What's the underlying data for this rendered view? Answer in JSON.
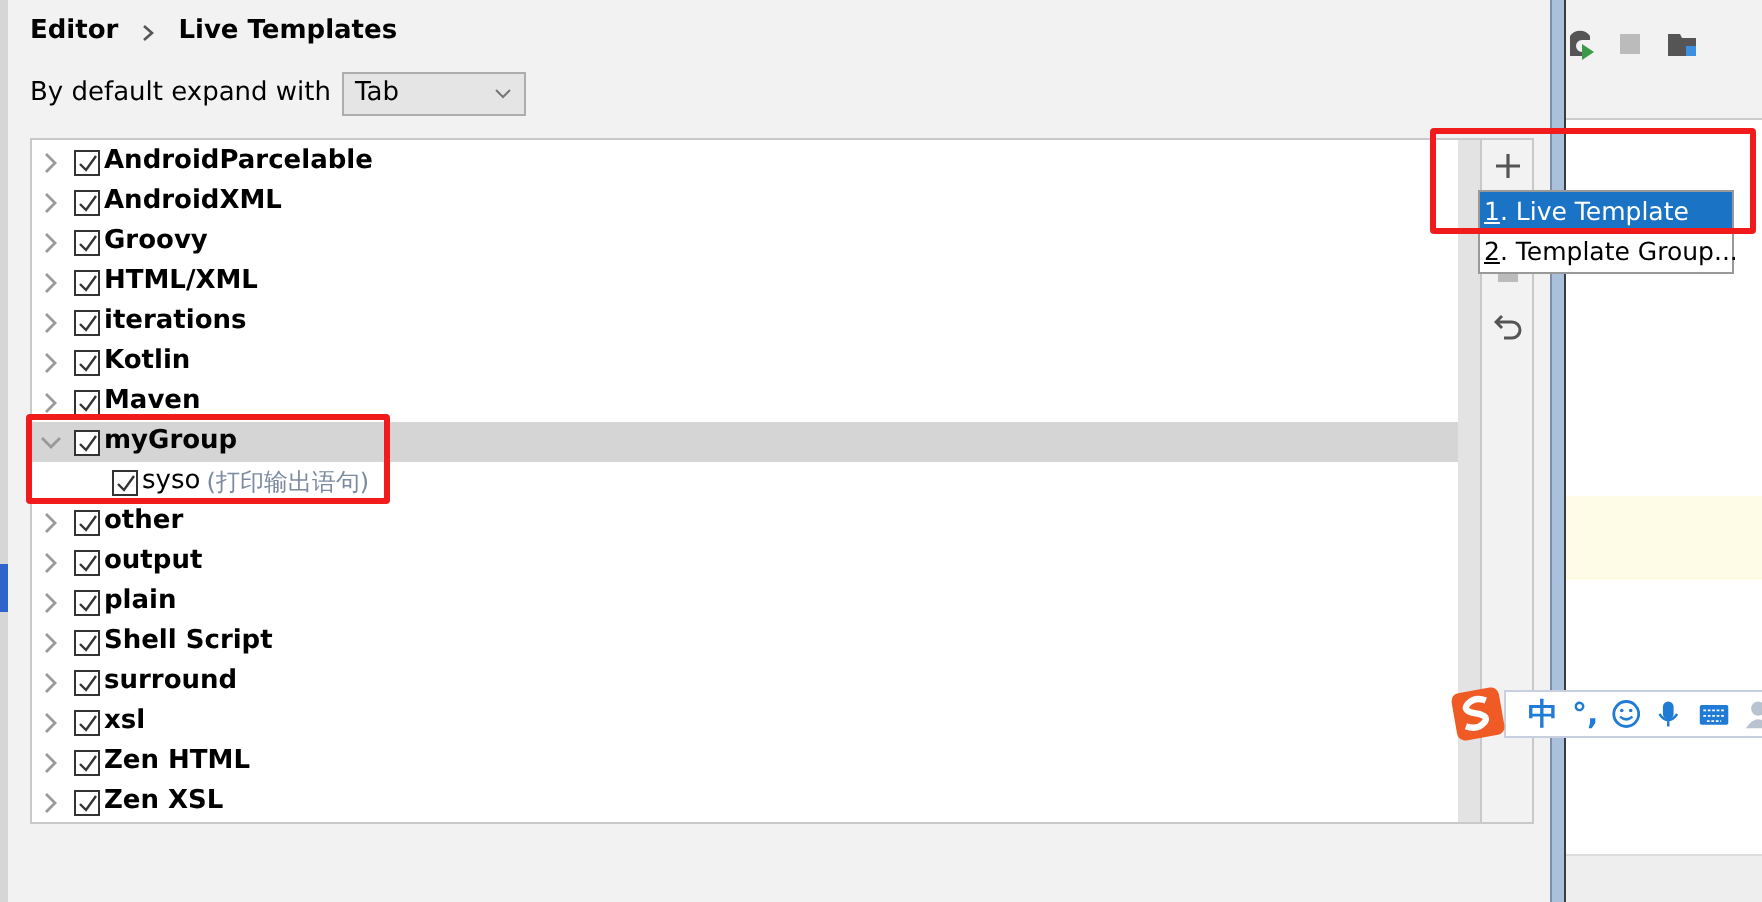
{
  "breadcrumb": [
    "Editor",
    "Live Templates"
  ],
  "expand": {
    "label": "By default expand with",
    "value": "Tab"
  },
  "groups": [
    {
      "label": "AndroidParcelable",
      "checked": true,
      "expanded": false,
      "selected": false
    },
    {
      "label": "AndroidXML",
      "checked": true,
      "expanded": false,
      "selected": false
    },
    {
      "label": "Groovy",
      "checked": true,
      "expanded": false,
      "selected": false
    },
    {
      "label": "HTML/XML",
      "checked": true,
      "expanded": false,
      "selected": false
    },
    {
      "label": "iterations",
      "checked": true,
      "expanded": false,
      "selected": false
    },
    {
      "label": "Kotlin",
      "checked": true,
      "expanded": false,
      "selected": false
    },
    {
      "label": "Maven",
      "checked": true,
      "expanded": false,
      "selected": false
    },
    {
      "label": "myGroup",
      "checked": true,
      "expanded": true,
      "selected": true,
      "children": [
        {
          "label": "syso",
          "description": "(打印输出语句)",
          "checked": true
        }
      ]
    },
    {
      "label": "other",
      "checked": true,
      "expanded": false,
      "selected": false
    },
    {
      "label": "output",
      "checked": true,
      "expanded": false,
      "selected": false
    },
    {
      "label": "plain",
      "checked": true,
      "expanded": false,
      "selected": false
    },
    {
      "label": "Shell Script",
      "checked": true,
      "expanded": false,
      "selected": false
    },
    {
      "label": "surround",
      "checked": true,
      "expanded": false,
      "selected": false
    },
    {
      "label": "xsl",
      "checked": true,
      "expanded": false,
      "selected": false
    },
    {
      "label": "Zen HTML",
      "checked": true,
      "expanded": false,
      "selected": false
    },
    {
      "label": "Zen XSL",
      "checked": true,
      "expanded": false,
      "selected": false
    }
  ],
  "toolbar": [
    {
      "kind": "add"
    },
    {
      "kind": "remove"
    },
    {
      "kind": "undo"
    }
  ],
  "add_menu": [
    {
      "mnemonic": "1",
      "label": ". Live Template",
      "selected": true
    },
    {
      "mnemonic": "2",
      "label": ". Template Group...",
      "selected": false
    }
  ],
  "ime_bar": {
    "items": [
      {
        "kind": "text",
        "text": "中"
      },
      {
        "kind": "text",
        "text": "°,"
      },
      {
        "kind": "emoji"
      },
      {
        "kind": "mic"
      },
      {
        "kind": "keyboard"
      },
      {
        "kind": "user"
      }
    ]
  }
}
